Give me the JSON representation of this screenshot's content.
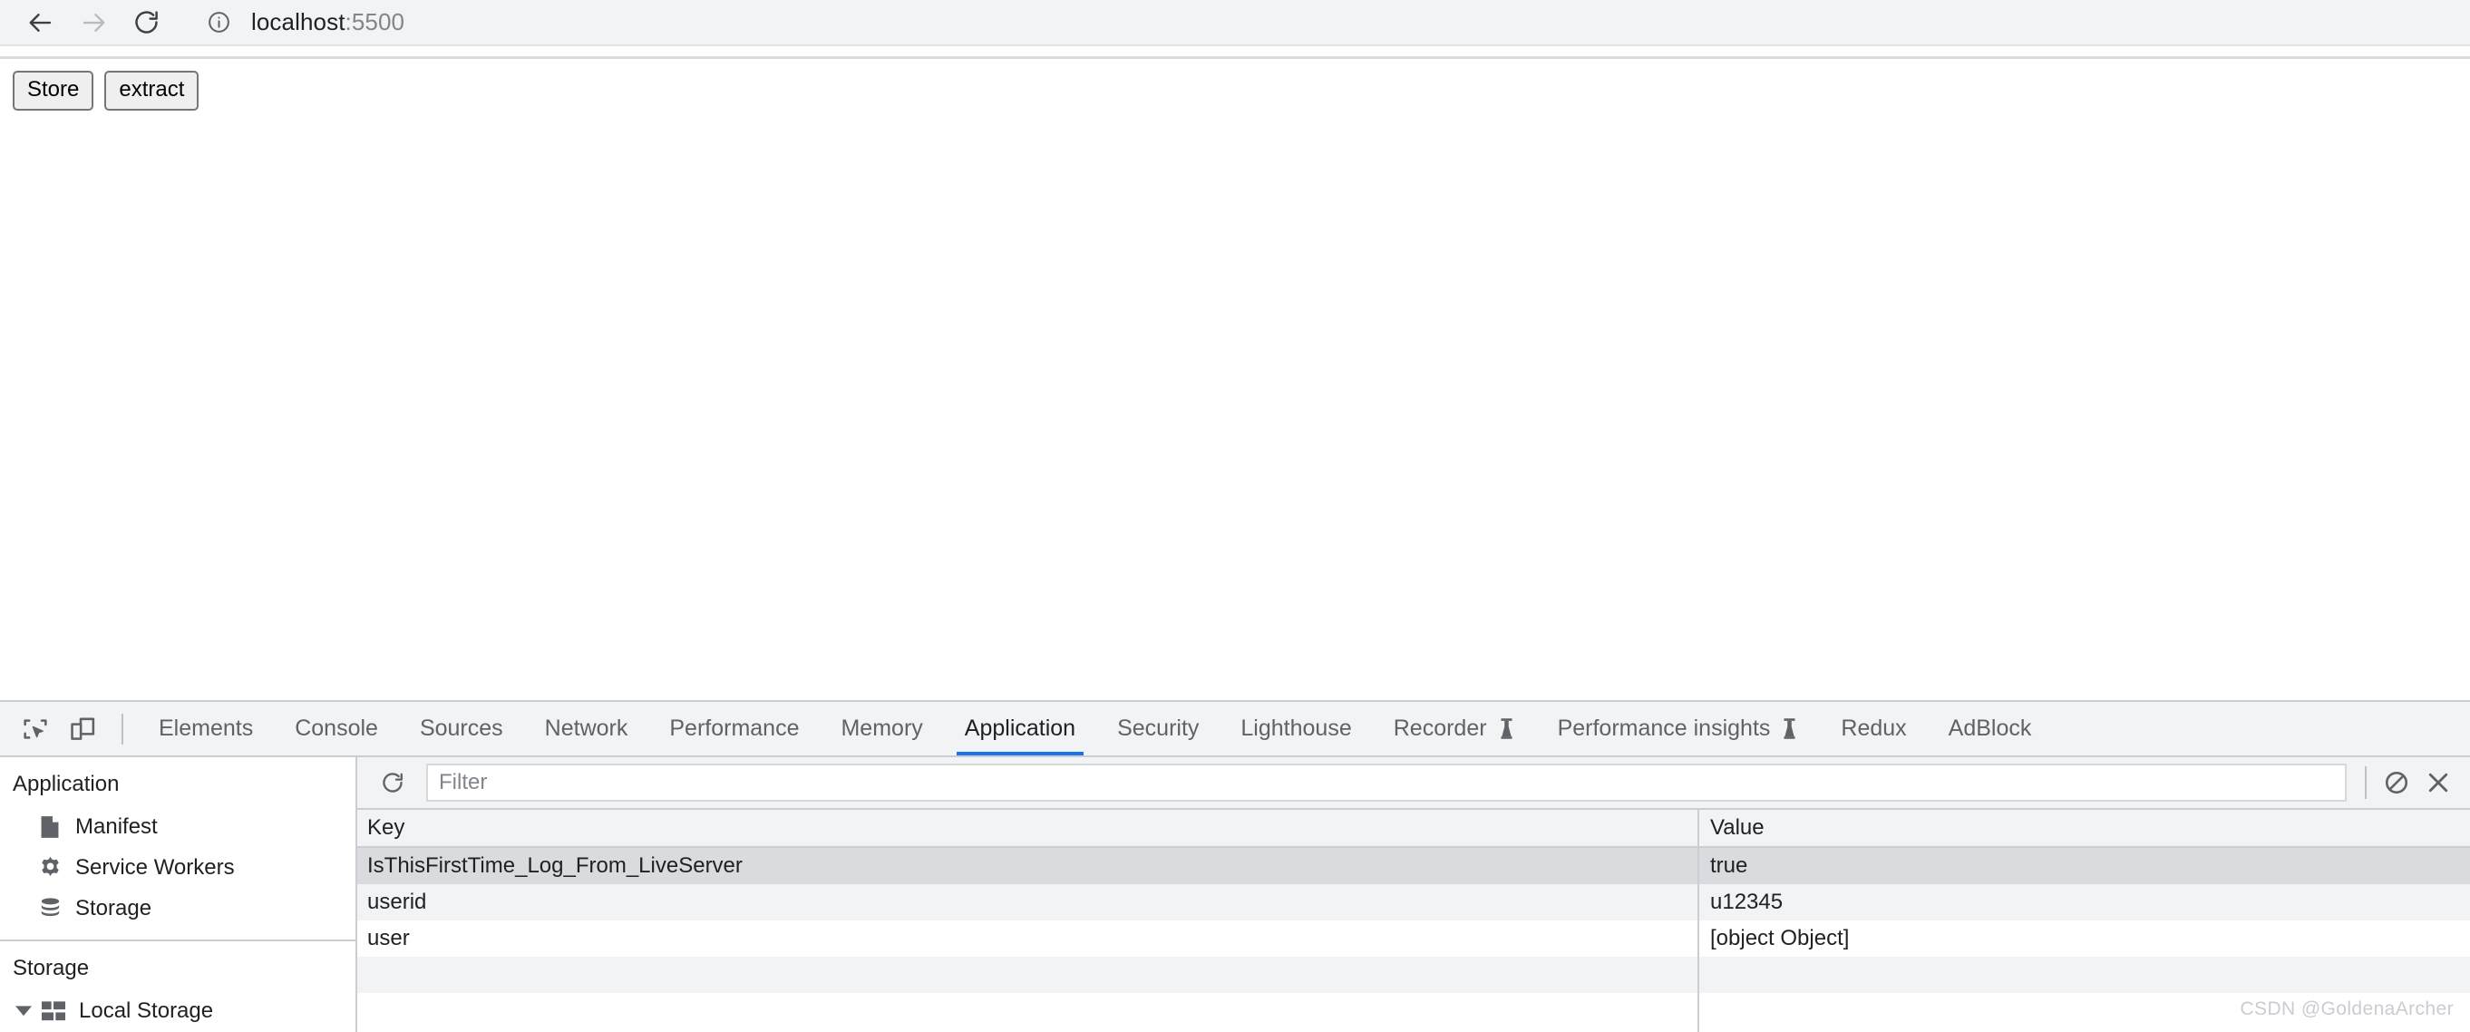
{
  "browser": {
    "back_label": "Back",
    "forward_label": "Forward",
    "reload_label": "Reload",
    "url_host": "localhost",
    "url_port": ":5500",
    "site_info_label": "View site information"
  },
  "page": {
    "buttons": [
      {
        "label": "Store",
        "name": "store-button"
      },
      {
        "label": "extract",
        "name": "extract-button"
      }
    ]
  },
  "devtools": {
    "tools": [
      {
        "label": "Inspect element",
        "name": "inspect-element-icon"
      },
      {
        "label": "Toggle device toolbar",
        "name": "device-toolbar-icon"
      }
    ],
    "tabs": [
      {
        "label": "Elements",
        "active": false,
        "flask": false
      },
      {
        "label": "Console",
        "active": false,
        "flask": false
      },
      {
        "label": "Sources",
        "active": false,
        "flask": false
      },
      {
        "label": "Network",
        "active": false,
        "flask": false
      },
      {
        "label": "Performance",
        "active": false,
        "flask": false
      },
      {
        "label": "Memory",
        "active": false,
        "flask": false
      },
      {
        "label": "Application",
        "active": true,
        "flask": false
      },
      {
        "label": "Security",
        "active": false,
        "flask": false
      },
      {
        "label": "Lighthouse",
        "active": false,
        "flask": false
      },
      {
        "label": "Recorder",
        "active": false,
        "flask": true
      },
      {
        "label": "Performance insights",
        "active": false,
        "flask": true
      },
      {
        "label": "Redux",
        "active": false,
        "flask": false
      },
      {
        "label": "AdBlock",
        "active": false,
        "flask": false
      }
    ],
    "sidebar": {
      "application_section": {
        "title": "Application",
        "items": [
          {
            "label": "Manifest",
            "icon": "document-icon"
          },
          {
            "label": "Service Workers",
            "icon": "gear-icon"
          },
          {
            "label": "Storage",
            "icon": "database-icon"
          }
        ]
      },
      "storage_section": {
        "title": "Storage",
        "items": [
          {
            "label": "Local Storage",
            "icon": "grid-icon",
            "expanded": true
          }
        ]
      }
    },
    "filterbar": {
      "refresh_label": "Refresh",
      "filter_placeholder": "Filter",
      "filter_value": "",
      "clear_all_label": "Clear all",
      "delete_selected_label": "Delete selected"
    },
    "table": {
      "columns": [
        "Key",
        "Value"
      ],
      "rows": [
        {
          "key": "IsThisFirstTime_Log_From_LiveServer",
          "value": "true",
          "selected": true
        },
        {
          "key": "userid",
          "value": "u12345",
          "selected": false
        },
        {
          "key": "user",
          "value": "[object Object]",
          "selected": false
        }
      ]
    }
  },
  "watermark": "CSDN @GoldenaArcher"
}
